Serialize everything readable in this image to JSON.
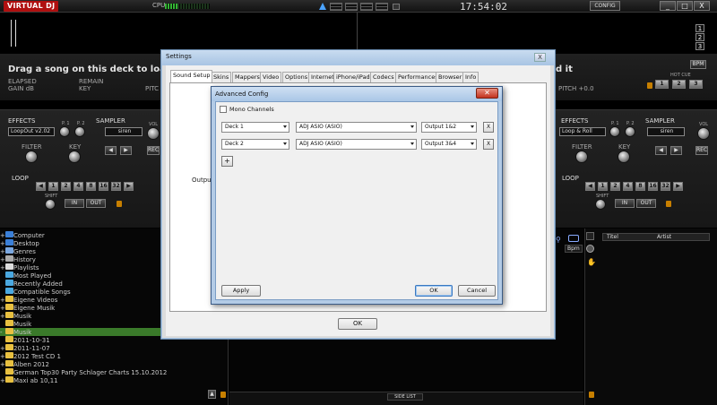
{
  "app": {
    "logo": "VIRTUAL DJ",
    "cpu_label": "CPU",
    "clock": "17:54:02",
    "config_label": "CONFIG",
    "window_buttons": [
      "_",
      "□",
      "X"
    ]
  },
  "deck_numbers": [
    "1",
    "2",
    "3"
  ],
  "deck_left": {
    "title": "Drag a song on this deck to load it",
    "elapsed_label": "ELAPSED",
    "gain_label": "GAIN dB",
    "remain_label": "REMAIN",
    "key_label": "KEY",
    "pitch_label": "PITC"
  },
  "deck_right": {
    "title": "d it",
    "pitch_label": "PITCH +0.0",
    "hot_cue_label": "HOT CUE",
    "bpm_label": "BPM",
    "hot_cues": [
      "1",
      "2",
      "3"
    ]
  },
  "fx_left": {
    "effects_label": "EFFECTS",
    "p1": "P. 1",
    "p2": "P. 2",
    "effect_value": "LoopOut v2.02",
    "sampler_label": "SAMPLER",
    "sampler_value": "siren",
    "vol_label": "VOL",
    "filter_label": "FILTER",
    "key_label": "KEY",
    "rec_label": "REC",
    "loop_label": "LOOP",
    "loop_values": [
      "1",
      "2",
      "4",
      "8",
      "16",
      "32"
    ],
    "shift_label": "SHIFT",
    "in_label": "IN",
    "out_label": "OUT"
  },
  "fx_right": {
    "effects_label": "EFFECTS",
    "p1": "P. 1",
    "p2": "P. 2",
    "effect_value": "Loop & Roll",
    "sampler_label": "SAMPLER",
    "sampler_value": "siren",
    "vol_label": "VOL",
    "filter_label": "FILTER",
    "key_label": "KEY",
    "rec_label": "REC",
    "loop_label": "LOOP",
    "loop_values": [
      "1",
      "2",
      "4",
      "8",
      "16",
      "32"
    ],
    "shift_label": "SHIFT",
    "in_label": "IN",
    "out_label": "OUT"
  },
  "browser": {
    "items": [
      {
        "label": "Computer",
        "prefix": "+",
        "icon": "computer-icon",
        "color": "#3a7fd8"
      },
      {
        "label": "Desktop",
        "prefix": "+",
        "icon": "desktop-icon",
        "color": "#3a7fd8"
      },
      {
        "label": "Genres",
        "prefix": "+",
        "icon": "genres-icon",
        "color": "#7aa7e0"
      },
      {
        "label": "History",
        "prefix": "+",
        "icon": "history-icon",
        "color": "#aaaaaa"
      },
      {
        "label": "Playlists",
        "prefix": "+",
        "icon": "playlist-icon",
        "color": "#dddddd"
      },
      {
        "label": "Most Played",
        "prefix": "",
        "icon": "filter-folder-icon",
        "color": "#4aa8e0"
      },
      {
        "label": "Recently Added",
        "prefix": "",
        "icon": "filter-folder-icon",
        "color": "#4aa8e0"
      },
      {
        "label": "Compatible Songs",
        "prefix": "",
        "icon": "filter-folder-icon",
        "color": "#4aa8e0"
      },
      {
        "label": "Eigene Videos",
        "prefix": "+",
        "icon": "folder-icon",
        "color": "#e8c040"
      },
      {
        "label": "Eigene Musik",
        "prefix": "+",
        "icon": "folder-icon",
        "color": "#e8c040"
      },
      {
        "label": "Musik",
        "prefix": "+",
        "icon": "folder-icon",
        "color": "#e8c040"
      },
      {
        "label": "Musik",
        "prefix": "",
        "icon": "folder-icon",
        "color": "#e8c040"
      },
      {
        "label": "Musik",
        "prefix": "-",
        "icon": "folder-icon",
        "color": "#e8c040",
        "selected": true
      },
      {
        "label": "2011-10-31",
        "prefix": "",
        "icon": "folder-icon",
        "color": "#e8c040",
        "indent": 1
      },
      {
        "label": "2011-11-07",
        "prefix": "+",
        "icon": "folder-icon",
        "color": "#e8c040",
        "indent": 1
      },
      {
        "label": "2012 Test CD 1",
        "prefix": "+",
        "icon": "folder-icon",
        "color": "#e8c040",
        "indent": 1
      },
      {
        "label": "Alben 2012",
        "prefix": "+",
        "icon": "folder-icon",
        "color": "#e8c040",
        "indent": 1
      },
      {
        "label": "German Top30 Party Schlager Charts 15.10.2012",
        "prefix": "",
        "icon": "folder-icon",
        "color": "#e8c040",
        "indent": 1
      },
      {
        "label": "Maxi ab 10,11",
        "prefix": "+",
        "icon": "folder-icon",
        "color": "#e8c040",
        "indent": 1
      }
    ]
  },
  "filelist": {
    "visible_header": "Bpm"
  },
  "sidelist": {
    "col_title": "Titel",
    "col_artist": "Artist",
    "tab_label": "SIDE LIST"
  },
  "settings": {
    "title": "Settings",
    "close": "X",
    "tabs": [
      "Sound Setup",
      "Skins",
      "Mappers",
      "Video",
      "Options",
      "Internet",
      "iPhone/iPad",
      "Codecs",
      "Performances",
      "Browser",
      "Info"
    ],
    "outputs_label": "Outputs",
    "ok_label": "OK"
  },
  "advanced": {
    "title": "Advanced Config",
    "close": "✕",
    "mono_label": "Mono Channels",
    "rows": [
      {
        "deck": "Deck 1",
        "device": "ADJ ASIO (ASIO)",
        "output": "Output 1&2",
        "remove": "X"
      },
      {
        "deck": "Deck 2",
        "device": "ADJ ASIO (ASIO)",
        "output": "Output 3&4",
        "remove": "X"
      }
    ],
    "add_label": "+",
    "apply_label": "Apply",
    "ok_label": "OK",
    "cancel_label": "Cancel"
  }
}
